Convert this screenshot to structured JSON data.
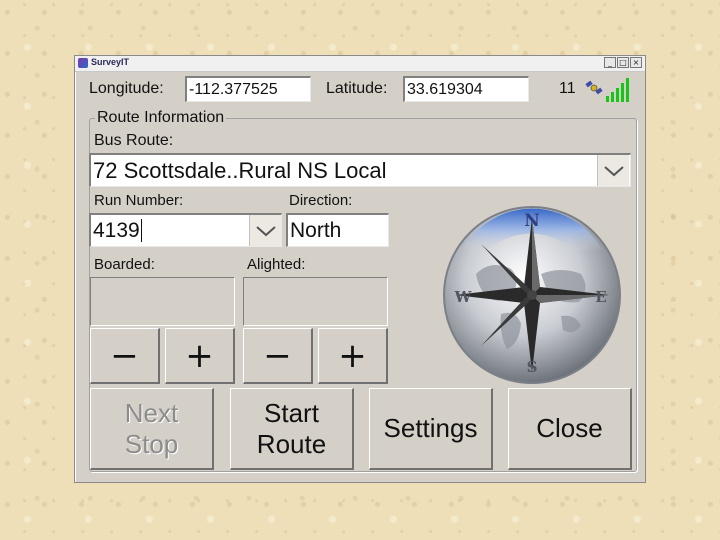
{
  "window": {
    "title": "SurveyIT",
    "controls": [
      "_",
      "□",
      "×"
    ]
  },
  "gps": {
    "longitude_label": "Longitude:",
    "longitude_value": "-112.377525",
    "latitude_label": "Latitude:",
    "latitude_value": "33.619304",
    "satellite_count": "11",
    "satellite_icon": "satellite-icon",
    "signal_icon": "signal-strength-icon",
    "signal_color": "#19c419"
  },
  "route_info": {
    "group_title": "Route Information",
    "bus_route_label": "Bus Route:",
    "bus_route_value": "72 Scottsdale..Rural NS Local",
    "run_number_label": "Run Number:",
    "run_number_value": "4139",
    "direction_label": "Direction:",
    "direction_value": "North"
  },
  "counters": {
    "boarded_label": "Boarded:",
    "alighted_label": "Alighted:",
    "minus_label": "−",
    "plus_label": "+"
  },
  "compass": {
    "north": "N",
    "south": "S",
    "east": "E",
    "west": "W"
  },
  "buttons": {
    "next_stop_line1": "Next",
    "next_stop_line2": "Stop",
    "start_route_line1": "Start",
    "start_route_line2": "Route",
    "settings": "Settings",
    "close": "Close"
  }
}
